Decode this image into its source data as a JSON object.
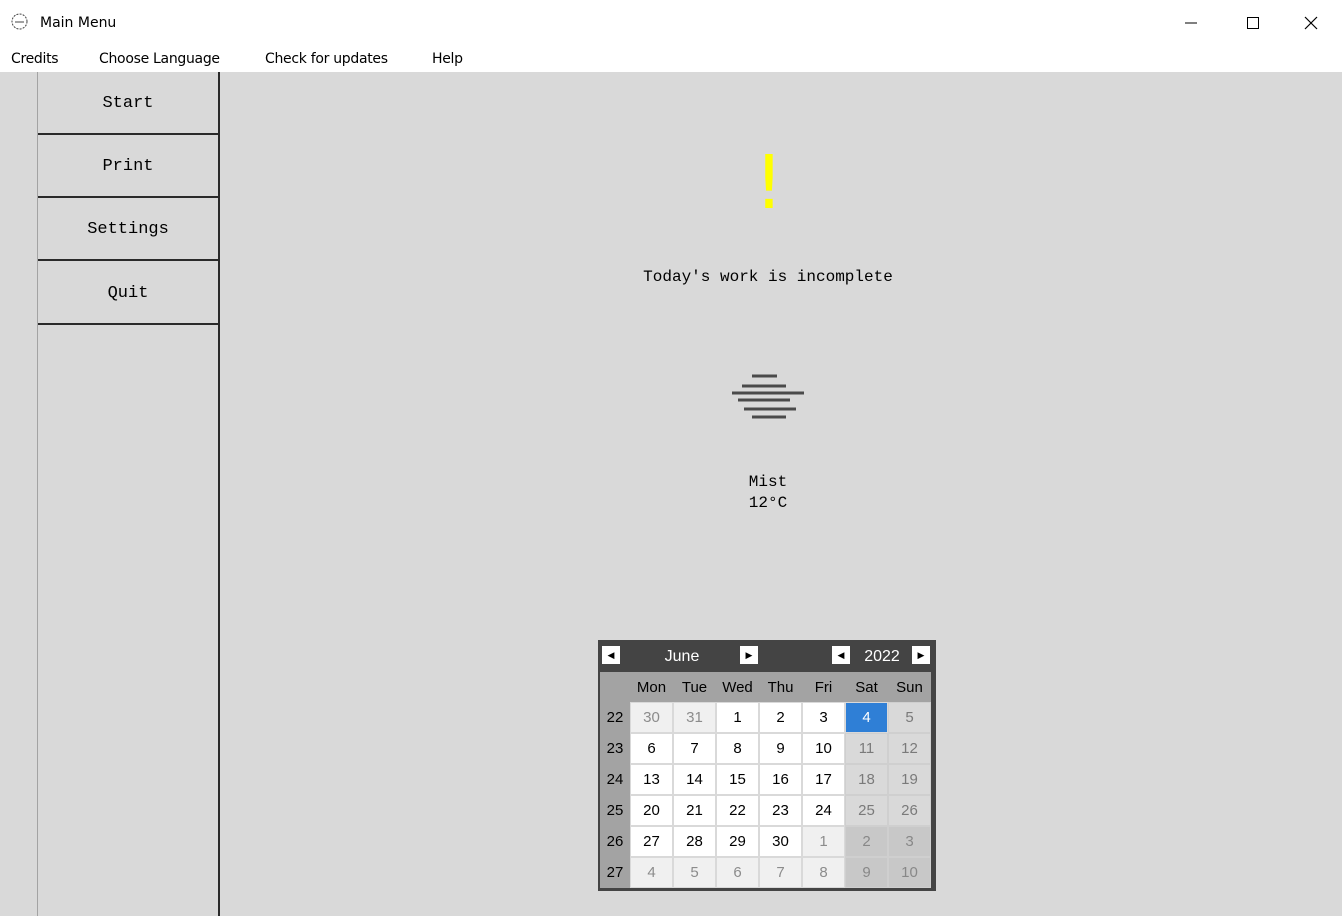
{
  "window": {
    "title": "Main Menu",
    "controls": [
      "minimize-icon",
      "maximize-icon",
      "close-icon"
    ]
  },
  "menubar": {
    "credits": "Credits",
    "choose_language": "Choose Language",
    "check_updates": "Check for updates",
    "help": "Help"
  },
  "sidebar": {
    "items": [
      {
        "label": "Start"
      },
      {
        "label": "Print"
      },
      {
        "label": "Settings"
      },
      {
        "label": "Quit"
      }
    ]
  },
  "status": {
    "icon": "exclamation-icon",
    "symbol": "!",
    "text": "Today's work is incomplete",
    "color": "#ffff00"
  },
  "weather": {
    "icon": "mist-icon",
    "condition": "Mist",
    "temperature": "12°C"
  },
  "calendar": {
    "month": "June",
    "year": "2022",
    "weekdays": [
      "Mon",
      "Tue",
      "Wed",
      "Thu",
      "Fri",
      "Sat",
      "Sun"
    ],
    "weeks": [
      {
        "number": "22",
        "days": [
          "30",
          "31",
          "1",
          "2",
          "3",
          "4",
          "5"
        ]
      },
      {
        "number": "23",
        "days": [
          "6",
          "7",
          "8",
          "9",
          "10",
          "11",
          "12"
        ]
      },
      {
        "number": "24",
        "days": [
          "13",
          "14",
          "15",
          "16",
          "17",
          "18",
          "19"
        ]
      },
      {
        "number": "25",
        "days": [
          "20",
          "21",
          "22",
          "23",
          "24",
          "25",
          "26"
        ]
      },
      {
        "number": "26",
        "days": [
          "27",
          "28",
          "29",
          "30",
          "1",
          "2",
          "3"
        ]
      },
      {
        "number": "27",
        "days": [
          "4",
          "5",
          "6",
          "7",
          "8",
          "9",
          "10"
        ]
      }
    ],
    "selected_day": "4",
    "selected_color": "#2f7fd6"
  }
}
